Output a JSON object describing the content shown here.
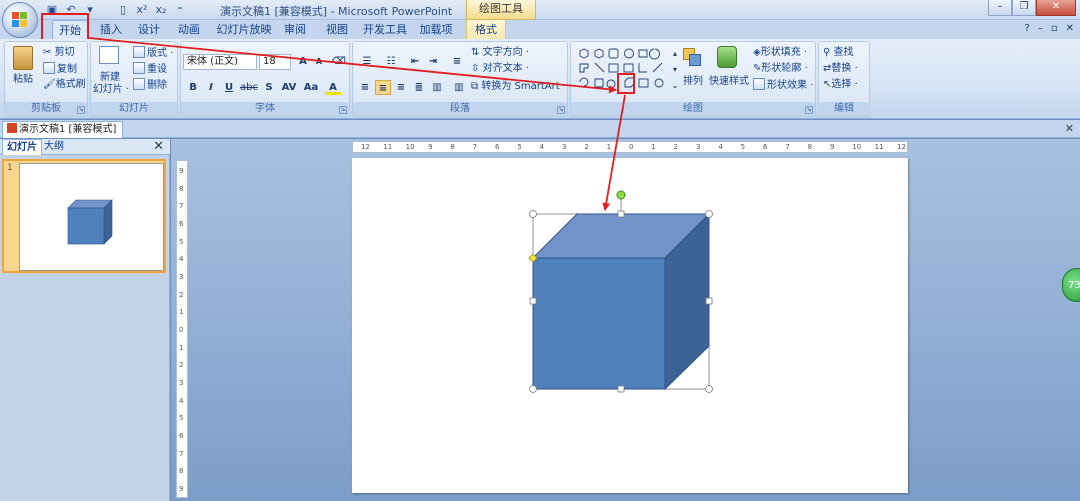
{
  "title": {
    "document": "演示文稿1 [兼容模式] - Microsoft PowerPoint",
    "context_group": "绘图工具"
  },
  "tabs": [
    "开始",
    "插入",
    "设计",
    "动画",
    "幻灯片放映",
    "审阅",
    "视图",
    "开发工具",
    "加载项",
    "格式"
  ],
  "active_tab": "开始",
  "ribbon": {
    "clipboard": {
      "paste": "粘贴",
      "cut": "剪切",
      "copy": "复制",
      "format_painter": "格式刷",
      "label": "剪贴板"
    },
    "slides": {
      "new_slide_1": "新建",
      "new_slide_2": "幻灯片 ·",
      "layout": "版式 ·",
      "reset": "重设",
      "delete": "删除",
      "label": "幻灯片"
    },
    "font": {
      "font_name": "宋体 (正文)",
      "font_size": "18",
      "bold": "B",
      "italic": "I",
      "underline": "U",
      "strike": "abc",
      "shadow": "S",
      "spacing": "AV",
      "case": "Aa",
      "color": "A",
      "grow": "A",
      "shrink": "A",
      "label": "字体"
    },
    "paragraph": {
      "text_direction": "文字方向 ·",
      "align_text": "对齐文本 ·",
      "smartart": "转换为 SmartArt ·",
      "label": "段落"
    },
    "drawing": {
      "arrange": "排列",
      "quick_styles": "快速样式",
      "fill": "形状填充 ·",
      "outline": "形状轮廓 ·",
      "effects": "形状效果 ·",
      "label": "绘图"
    },
    "editing": {
      "find": "查找",
      "replace": "替换 ·",
      "select": "选择 ·",
      "label": "编辑"
    }
  },
  "document_tab": "演示文稿1 [兼容模式]",
  "panel_tabs": [
    "幻灯片",
    "大纲"
  ],
  "slide_number": "1",
  "badge": "73",
  "ruler": {
    "h_labels": [
      "12",
      "11",
      "10",
      "9",
      "8",
      "7",
      "6",
      "5",
      "4",
      "3",
      "2",
      "1",
      "0",
      "1",
      "2",
      "3",
      "4",
      "5",
      "6",
      "7",
      "8",
      "9",
      "10",
      "11",
      "12"
    ],
    "v_labels": [
      "9",
      "8",
      "7",
      "6",
      "5",
      "4",
      "3",
      "2",
      "1",
      "0",
      "1",
      "2",
      "3",
      "4",
      "5",
      "6",
      "7",
      "8",
      "9"
    ]
  },
  "colors": {
    "cube_front": "#4f81bd",
    "cube_top": "#7394c9",
    "cube_side": "#3d6296",
    "annotation": "#e41d1d"
  }
}
